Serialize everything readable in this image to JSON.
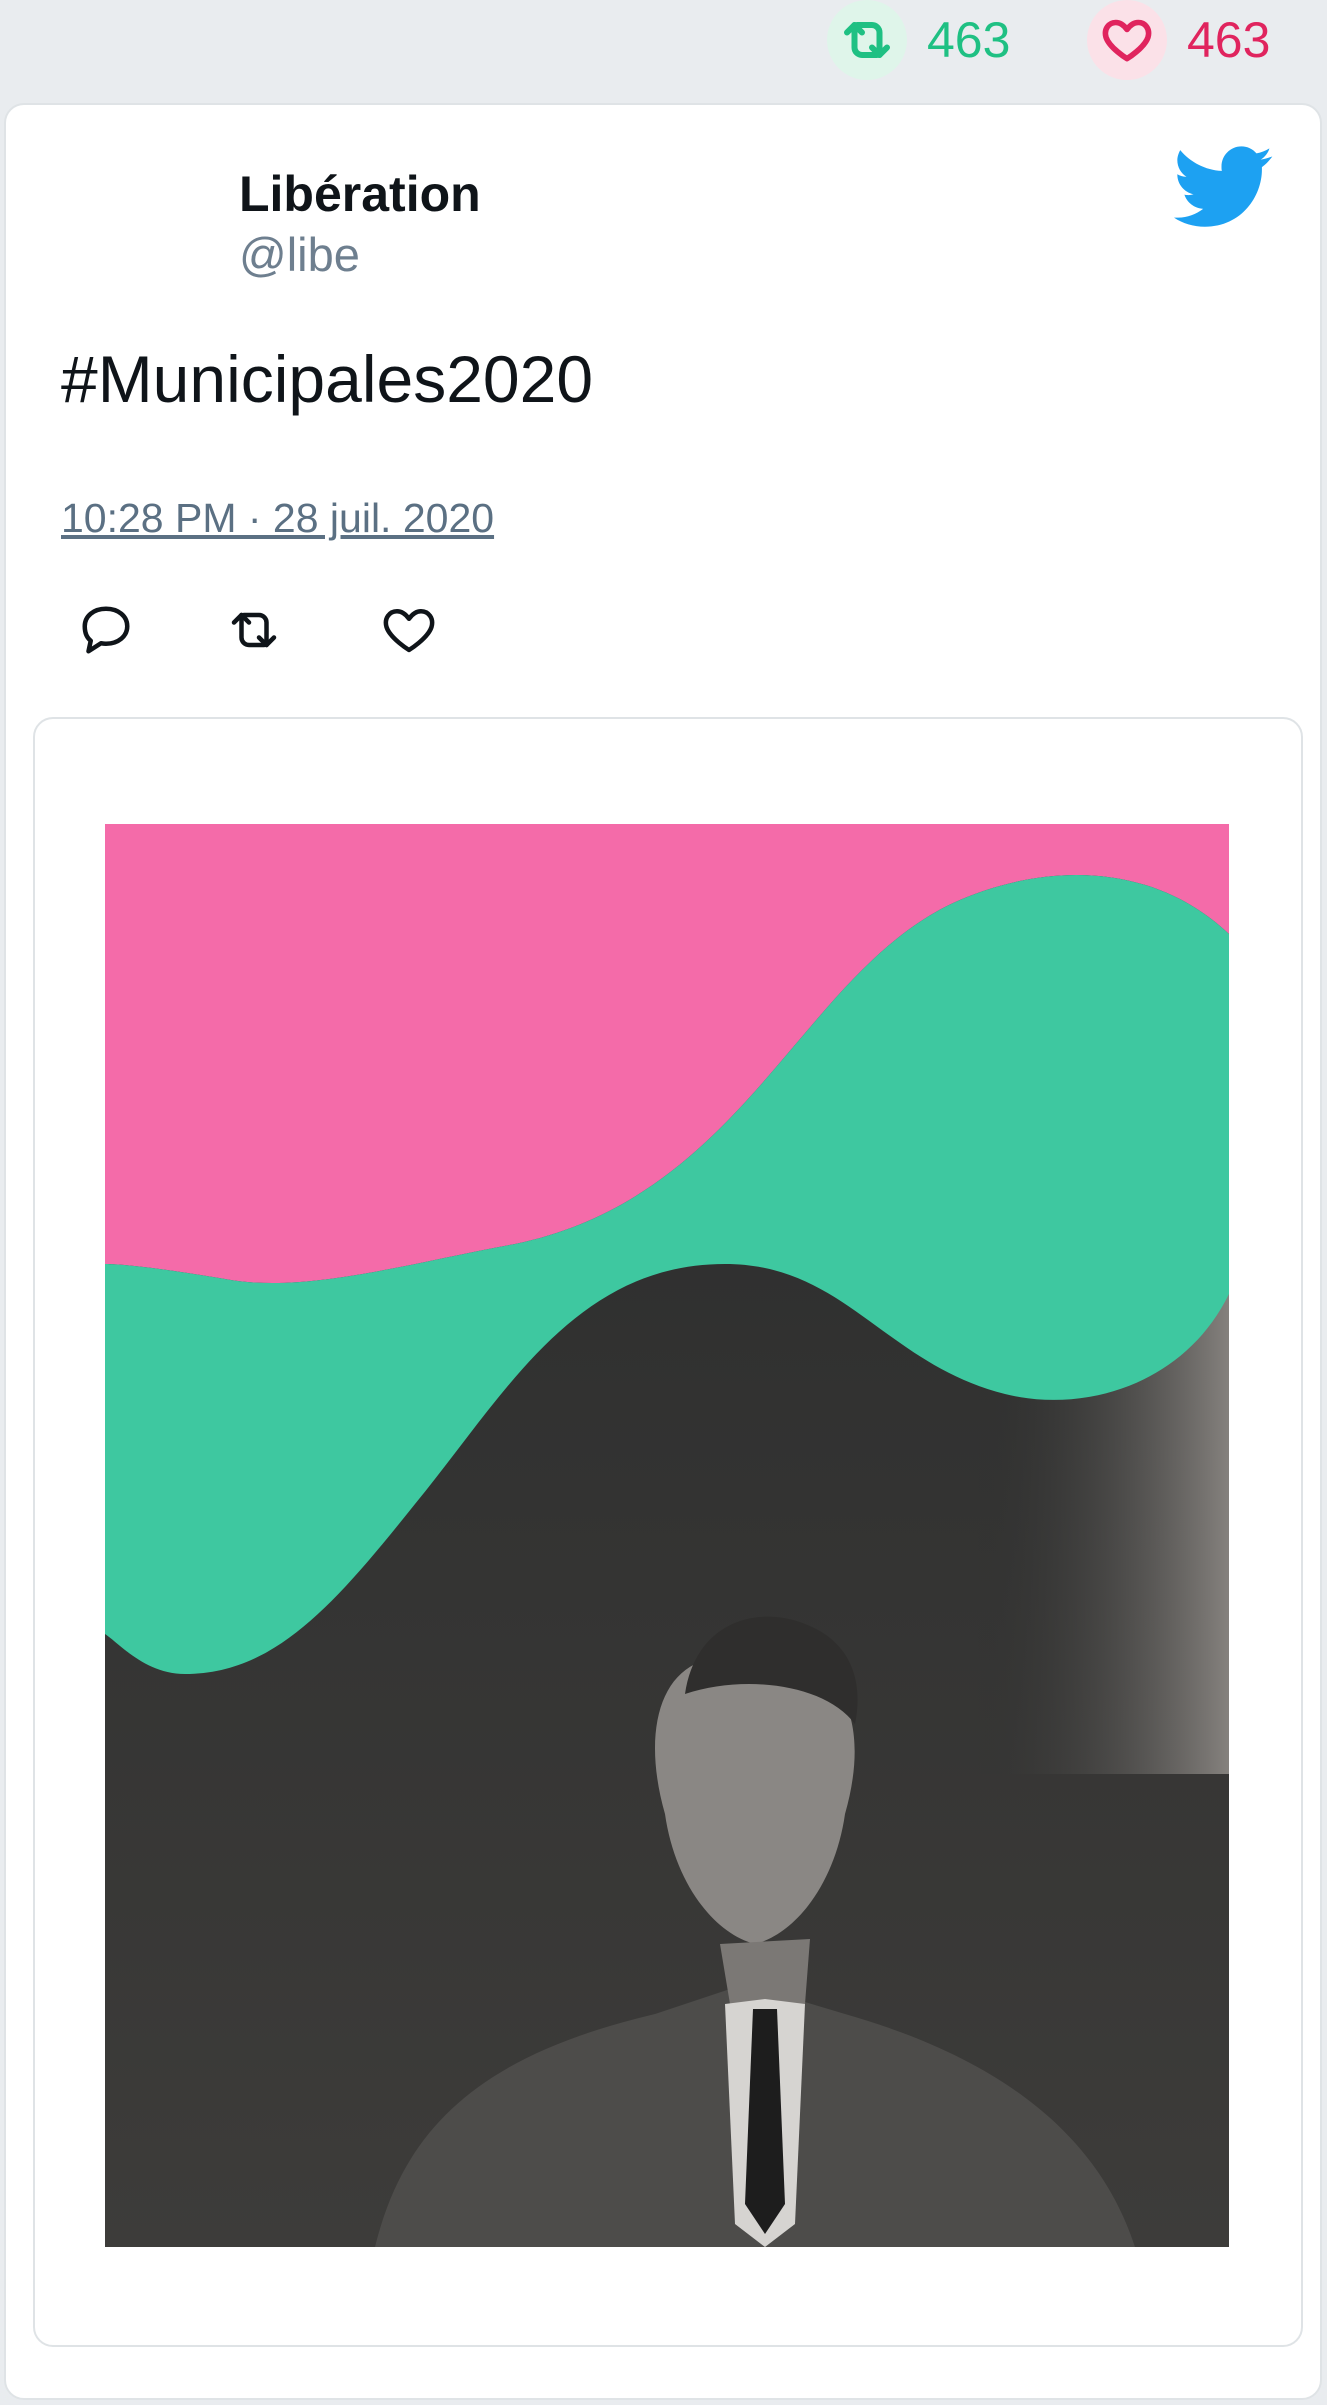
{
  "stats": {
    "retweet_count": "463",
    "like_count": "463"
  },
  "tweet": {
    "author_name": "Libération",
    "author_handle": "@libe",
    "text": "#Municipales2020",
    "timestamp": "10:28 PM · 28 juil. 2020"
  },
  "icons": {
    "brand": "twitter-bird-icon",
    "actions": [
      "reply-icon",
      "retweet-icon",
      "like-icon"
    ]
  },
  "colors": {
    "retweet": "#1fc083",
    "like": "#e0245e",
    "brand": "#1da1f2",
    "photo_pink": "#f46ba9",
    "photo_green": "#3ec8a0",
    "photo_dark": "#2a2b2b"
  }
}
